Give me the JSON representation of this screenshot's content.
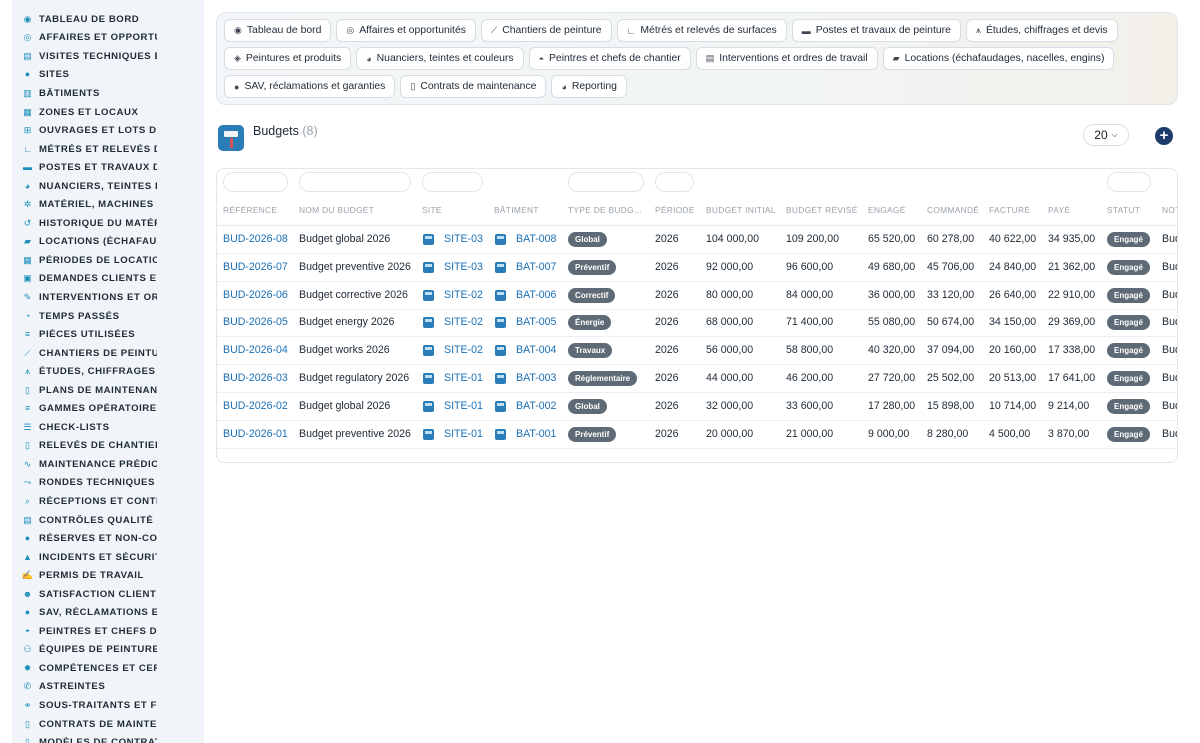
{
  "sidebar": {
    "items": [
      {
        "label": "TABLEAU DE BORD",
        "icon": "dashboard-icon"
      },
      {
        "label": "AFFAIRES ET OPPORTUNITÉS",
        "icon": "target-icon"
      },
      {
        "label": "VISITES TECHNIQUES ET",
        "icon": "clipboard-icon"
      },
      {
        "label": "SITES",
        "icon": "map-pin-icon"
      },
      {
        "label": "BÂTIMENTS",
        "icon": "building-icon"
      },
      {
        "label": "ZONES ET LOCAUX",
        "icon": "grid-icon"
      },
      {
        "label": "OUVRAGES ET LOTS DE TRAVAUX",
        "icon": "sitemap-icon"
      },
      {
        "label": "MÉTRÉS ET RELEVÉS DE SURFACES",
        "icon": "ruler-icon"
      },
      {
        "label": "POSTES ET TRAVAUX DE PEINTURE",
        "icon": "paint-roller-icon"
      },
      {
        "label": "NUANCIERS, TEINTES ET COULEURS",
        "icon": "palette-icon"
      },
      {
        "label": "MATÉRIEL, MACHINES ET ENGINS",
        "icon": "cogs-icon"
      },
      {
        "label": "HISTORIQUE DU MATÉRIEL",
        "icon": "history-icon"
      },
      {
        "label": "LOCATIONS (ÉCHAFAUDAGES)",
        "icon": "truck-icon"
      },
      {
        "label": "PÉRIODES DE LOCATION",
        "icon": "calendar-icon"
      },
      {
        "label": "DEMANDES CLIENTS ET INTERVENTIONS",
        "icon": "inbox-icon"
      },
      {
        "label": "INTERVENTIONS ET ORDRES",
        "icon": "wrench-icon"
      },
      {
        "label": "TEMPS PASSÉS",
        "icon": "clock-icon"
      },
      {
        "label": "PIÈCES UTILISÉES",
        "icon": "list-icon"
      },
      {
        "label": "CHANTIERS DE PEINTURE",
        "icon": "hammer-icon"
      },
      {
        "label": "ÉTUDES, CHIFFRAGES ET DEVIS",
        "icon": "drafting-icon"
      },
      {
        "label": "PLANS DE MAINTENANCE",
        "icon": "document-icon"
      },
      {
        "label": "GAMMES OPÉRATOIRES",
        "icon": "list-icon"
      },
      {
        "label": "CHECK-LISTS",
        "icon": "checklist-icon"
      },
      {
        "label": "RELEVÉS DE CHANTIER",
        "icon": "file-icon"
      },
      {
        "label": "MAINTENANCE PRÉDICTIVE",
        "icon": "chart-line-icon"
      },
      {
        "label": "RONDES TECHNIQUES",
        "icon": "route-icon"
      },
      {
        "label": "RÉCEPTIONS ET CONTRÔLES",
        "icon": "search-icon"
      },
      {
        "label": "CONTRÔLES QUALITÉ ET",
        "icon": "clipboard-check-icon"
      },
      {
        "label": "RÉSERVES ET NON-CONFORMITÉS",
        "icon": "alert-circle-icon"
      },
      {
        "label": "INCIDENTS ET SÉCURITÉ",
        "icon": "warning-icon"
      },
      {
        "label": "PERMIS DE TRAVAIL",
        "icon": "file-signature-icon"
      },
      {
        "label": "SATISFACTION CLIENT",
        "icon": "smile-icon"
      },
      {
        "label": "SAV, RÉCLAMATIONS ET GARANTIES",
        "icon": "comment-icon"
      },
      {
        "label": "PEINTRES ET CHEFS DE CHANTIER",
        "icon": "helmet-icon"
      },
      {
        "label": "ÉQUIPES DE PEINTURE",
        "icon": "users-icon"
      },
      {
        "label": "COMPÉTENCES ET CERTIFICATIONS",
        "icon": "badge-icon"
      },
      {
        "label": "ASTREINTES",
        "icon": "phone-icon"
      },
      {
        "label": "SOUS-TRAITANTS ET FOURNISSEURS",
        "icon": "handshake-icon"
      },
      {
        "label": "CONTRATS DE MAINTENANCE",
        "icon": "file-contract-icon"
      },
      {
        "label": "MODÈLES DE CONTRATS",
        "icon": "file-alt-icon"
      }
    ]
  },
  "topnav": {
    "rows": [
      [
        {
          "label": "Tableau de bord",
          "icon": "dashboard-icon"
        },
        {
          "label": "Affaires et opportunités",
          "icon": "target-icon"
        },
        {
          "label": "Chantiers de peinture",
          "icon": "hammer-icon"
        },
        {
          "label": "Métrés et relevés de surfaces",
          "icon": "ruler-icon"
        },
        {
          "label": "Postes et travaux de peinture",
          "icon": "paint-roller-icon"
        },
        {
          "label": "Études, chiffrages et devis",
          "icon": "drafting-icon"
        }
      ],
      [
        {
          "label": "Peintures et produits",
          "icon": "fill-icon"
        },
        {
          "label": "Nuanciers, teintes et couleurs",
          "icon": "palette-icon"
        },
        {
          "label": "Peintres et chefs de chantier",
          "icon": "helmet-icon"
        },
        {
          "label": "Interventions et ordres de travail",
          "icon": "clipboard-icon"
        },
        {
          "label": "Locations (échafaudages, nacelles, engins)",
          "icon": "truck-icon"
        }
      ],
      [
        {
          "label": "SAV, réclamations et garanties",
          "icon": "comment-icon"
        },
        {
          "label": "Contrats de maintenance",
          "icon": "file-contract-icon"
        },
        {
          "label": "Reporting",
          "icon": "pie-chart-icon"
        }
      ]
    ]
  },
  "header": {
    "title": "Budgets",
    "count": "(8)",
    "per_page": "20"
  },
  "table": {
    "columns": [
      "RÉFÉRENCE",
      "NOM DU BUDGET",
      "SITE",
      "BÂTIMENT",
      "TYPE DE BUDG...",
      "PÉRIODE",
      "BUDGET INITIAL",
      "BUDGET RÉVISÉ",
      "ENGAGÉ",
      "COMMANDÉ",
      "FACTURÉ",
      "PAYÉ",
      "STATUT",
      "NOT"
    ],
    "rows": [
      {
        "ref": "BUD-2026-08",
        "name": "Budget global 2026",
        "site": "SITE-03",
        "building": "BAT-008",
        "type": "Global",
        "period": "2026",
        "initial": "104 000,00",
        "revised": "109 200,00",
        "committed": "65 520,00",
        "ordered": "60 278,00",
        "invoiced": "40 622,00",
        "paid": "34 935,00",
        "status": "Engagé",
        "note": "Bud"
      },
      {
        "ref": "BUD-2026-07",
        "name": "Budget preventive 2026",
        "site": "SITE-03",
        "building": "BAT-007",
        "type": "Préventif",
        "period": "2026",
        "initial": "92 000,00",
        "revised": "96 600,00",
        "committed": "49 680,00",
        "ordered": "45 706,00",
        "invoiced": "24 840,00",
        "paid": "21 362,00",
        "status": "Engagé",
        "note": "Bud"
      },
      {
        "ref": "BUD-2026-06",
        "name": "Budget corrective 2026",
        "site": "SITE-02",
        "building": "BAT-006",
        "type": "Correctif",
        "period": "2026",
        "initial": "80 000,00",
        "revised": "84 000,00",
        "committed": "36 000,00",
        "ordered": "33 120,00",
        "invoiced": "26 640,00",
        "paid": "22 910,00",
        "status": "Engagé",
        "note": "Bud"
      },
      {
        "ref": "BUD-2026-05",
        "name": "Budget energy 2026",
        "site": "SITE-02",
        "building": "BAT-005",
        "type": "Énergie",
        "period": "2026",
        "initial": "68 000,00",
        "revised": "71 400,00",
        "committed": "55 080,00",
        "ordered": "50 674,00",
        "invoiced": "34 150,00",
        "paid": "29 369,00",
        "status": "Engagé",
        "note": "Bud"
      },
      {
        "ref": "BUD-2026-04",
        "name": "Budget works 2026",
        "site": "SITE-02",
        "building": "BAT-004",
        "type": "Travaux",
        "period": "2026",
        "initial": "56 000,00",
        "revised": "58 800,00",
        "committed": "40 320,00",
        "ordered": "37 094,00",
        "invoiced": "20 160,00",
        "paid": "17 338,00",
        "status": "Engagé",
        "note": "Bud"
      },
      {
        "ref": "BUD-2026-03",
        "name": "Budget regulatory 2026",
        "site": "SITE-01",
        "building": "BAT-003",
        "type": "Réglementaire",
        "period": "2026",
        "initial": "44 000,00",
        "revised": "46 200,00",
        "committed": "27 720,00",
        "ordered": "25 502,00",
        "invoiced": "20 513,00",
        "paid": "17 641,00",
        "status": "Engagé",
        "note": "Bud"
      },
      {
        "ref": "BUD-2026-02",
        "name": "Budget global 2026",
        "site": "SITE-01",
        "building": "BAT-002",
        "type": "Global",
        "period": "2026",
        "initial": "32 000,00",
        "revised": "33 600,00",
        "committed": "17 280,00",
        "ordered": "15 898,00",
        "invoiced": "10 714,00",
        "paid": "9 214,00",
        "status": "Engagé",
        "note": "Bud"
      },
      {
        "ref": "BUD-2026-01",
        "name": "Budget preventive 2026",
        "site": "SITE-01",
        "building": "BAT-001",
        "type": "Préventif",
        "period": "2026",
        "initial": "20 000,00",
        "revised": "21 000,00",
        "committed": "9 000,00",
        "ordered": "8 280,00",
        "invoiced": "4 500,00",
        "paid": "3 870,00",
        "status": "Engagé",
        "note": "Bud"
      }
    ]
  },
  "colors": {
    "accent": "#1a8fb8",
    "link": "#1a6fb5",
    "badge": "#5e6a75",
    "add_button": "#1c3a6b",
    "sidebar_bg": "#f1f5fa"
  }
}
